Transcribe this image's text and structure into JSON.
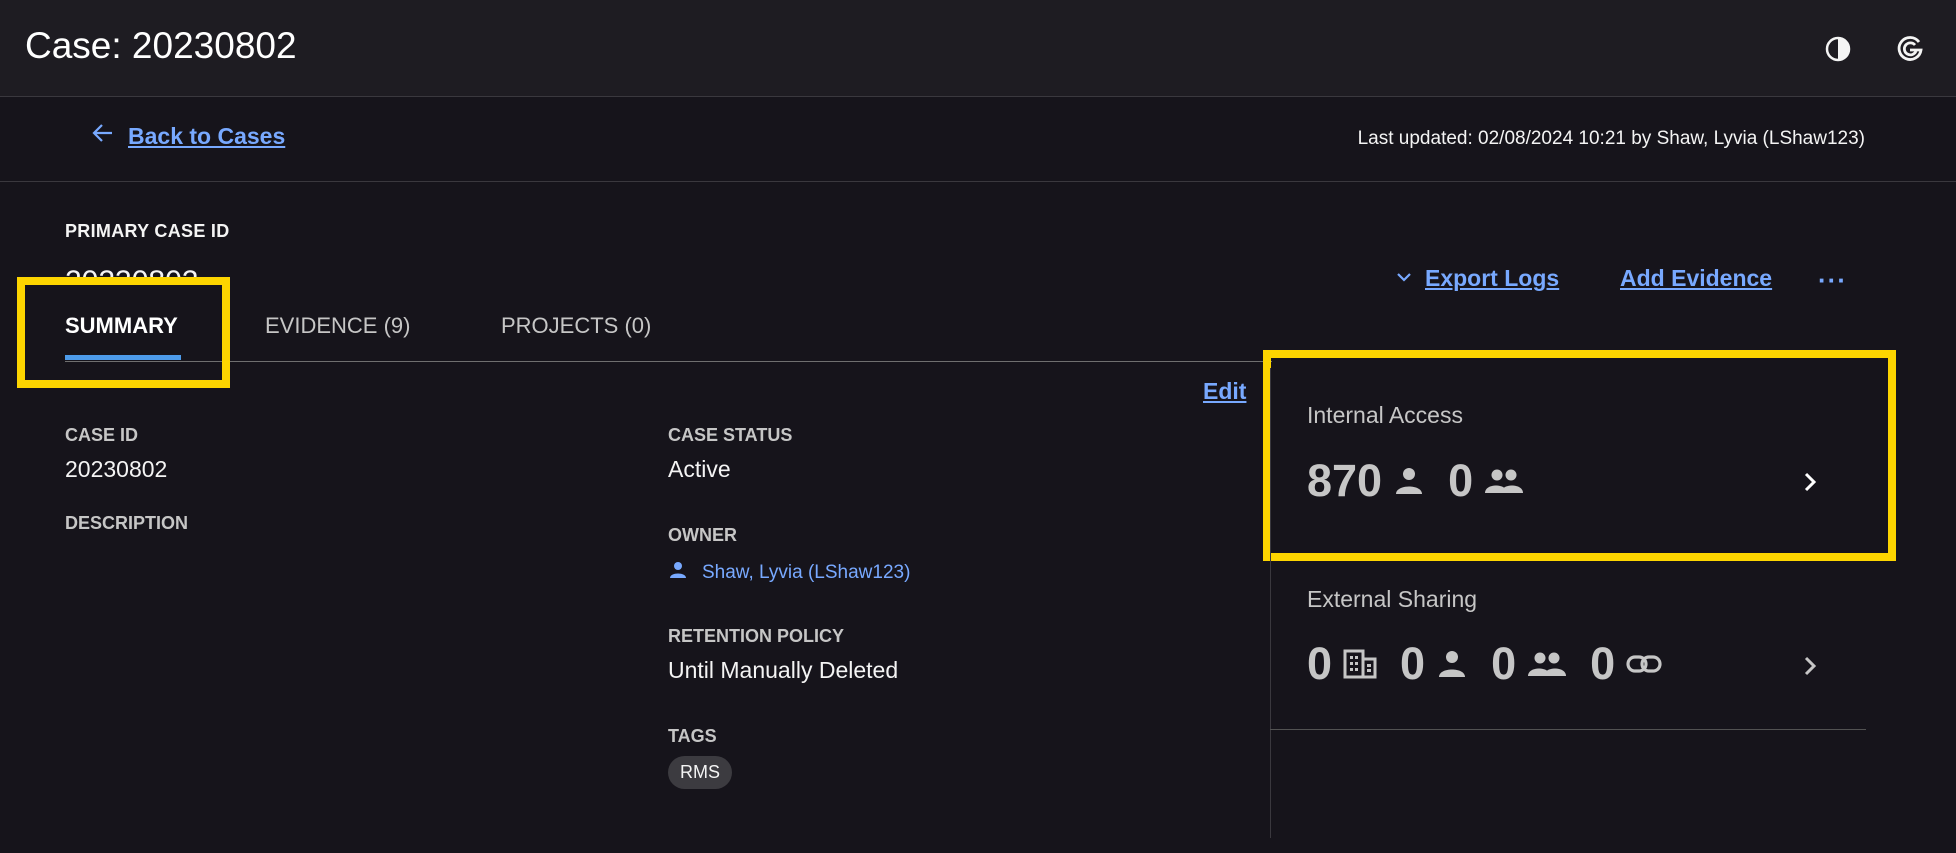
{
  "header": {
    "title": "Case: 20230802",
    "icons": [
      "contrast-icon",
      "account-g-icon"
    ]
  },
  "subbar": {
    "back_label": "Back to Cases",
    "last_updated": "Last updated: 02/08/2024 10:21 by Shaw, Lyvia (LShaw123)"
  },
  "case": {
    "primary_id_label": "PRIMARY CASE ID",
    "primary_id_value": "20230802"
  },
  "tabs": [
    {
      "label": "SUMMARY",
      "active": true
    },
    {
      "label": "EVIDENCE (9)",
      "active": false
    },
    {
      "label": "PROJECTS (0)",
      "active": false
    }
  ],
  "actions": {
    "export_logs": "Export Logs",
    "add_evidence": "Add Evidence",
    "overflow": "···"
  },
  "summary": {
    "edit": "Edit",
    "case_id_label": "CASE ID",
    "case_id_value": "20230802",
    "description_label": "DESCRIPTION",
    "case_status_label": "CASE STATUS",
    "case_status_value": "Active",
    "owner_label": "OWNER",
    "owner_value": "Shaw, Lyvia (LShaw123)",
    "retention_label": "RETENTION POLICY",
    "retention_value": "Until Manually Deleted",
    "tags_label": "TAGS",
    "tags": [
      "RMS"
    ]
  },
  "internal_access": {
    "title": "Internal Access",
    "users": "870",
    "groups": "0"
  },
  "external_sharing": {
    "title": "External Sharing",
    "organizations": "0",
    "users": "0",
    "groups": "0",
    "links": "0"
  },
  "colors": {
    "background": "#16141b",
    "link": "#78a9ff",
    "highlight": "#fdd500",
    "tab_underline": "#4d9bea"
  }
}
